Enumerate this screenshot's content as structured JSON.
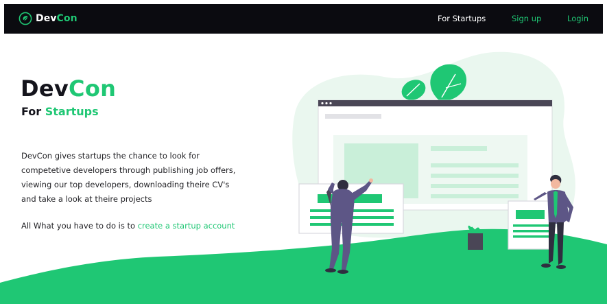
{
  "nav": {
    "brand_prefix": "Dev",
    "brand_accent": "Con",
    "links": {
      "startups": "For Startups",
      "signup": "Sign up",
      "login": "Login"
    }
  },
  "hero": {
    "title_prefix": "Dev",
    "title_accent": "Con",
    "subtitle_prefix": "For ",
    "subtitle_accent": "Startups",
    "description": "DevCon gives startups the chance to look for competetive developers through publishing job offers, viewing our top developers, downloading theire CV's and take a look at theire projects",
    "cta_text": "All What you have to do is to ",
    "cta_link": "create a startup account"
  },
  "colors": {
    "navbar": "#0b0b10",
    "accent": "#1fc774",
    "text": "#14141c",
    "soft_green": "#e9f7ef"
  },
  "icons": {
    "brand": "leaf-circle-icon"
  }
}
